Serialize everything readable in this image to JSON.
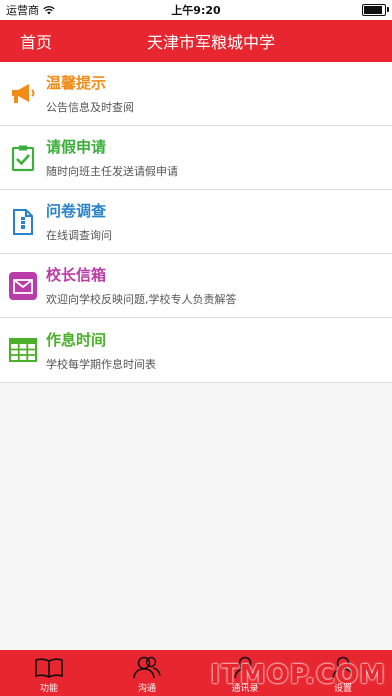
{
  "status": {
    "carrier": "运营商",
    "time": "上午9:20",
    "battery_level": 0.9
  },
  "nav": {
    "home": "首页",
    "title": "天津市军粮城中学"
  },
  "items": [
    {
      "icon": "megaphone-icon",
      "title": "温馨提示",
      "subtitle": "公告信息及时查阅",
      "color": "#f08c1a"
    },
    {
      "icon": "clipboard-check-icon",
      "title": "请假申请",
      "subtitle": "随时向班主任发送请假申请",
      "color": "#3cae3c"
    },
    {
      "icon": "document-icon",
      "title": "问卷调查",
      "subtitle": "在线调查询问",
      "color": "#2a82c9"
    },
    {
      "icon": "mail-icon",
      "title": "校长信箱",
      "subtitle": "欢迎向学校反映问题,学校专人负责解答",
      "color": "#b83da8"
    },
    {
      "icon": "table-grid-icon",
      "title": "作息时间",
      "subtitle": "学校每学期作息时间表",
      "color": "#4caf2a"
    }
  ],
  "tabs": [
    {
      "icon": "book-icon",
      "label": "功能"
    },
    {
      "icon": "users-icon",
      "label": "沟通"
    },
    {
      "icon": "contacts-icon",
      "label": "通讯录"
    },
    {
      "icon": "settings-person-icon",
      "label": "设置"
    }
  ],
  "watermark": "ITMOP.COM"
}
